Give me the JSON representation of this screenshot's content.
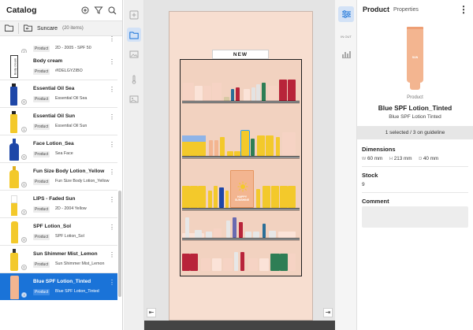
{
  "catalog": {
    "title": "Catalog",
    "folder": {
      "name": "Suncare",
      "count": "(20 items)"
    },
    "items": [
      {
        "name": "",
        "tag": "Product",
        "value": "2D - 2005 - SPF 50",
        "badge": "2"
      },
      {
        "name": "Body cream",
        "tag": "Product",
        "value": "#IDELGYZIBO",
        "badge": "",
        "thumb_text": "Body cream"
      },
      {
        "name": "Essential Oil Sea",
        "tag": "Product",
        "value": "Essential Oil Sea",
        "badge": "0"
      },
      {
        "name": "Essential Oil Sun",
        "tag": "Product",
        "value": "Essential Oil Sun",
        "badge": "1"
      },
      {
        "name": "Face Lotion_Sea",
        "tag": "Product",
        "value": "Sea Face",
        "badge": "0"
      },
      {
        "name": "Fun Size Body Lotion_Yellow",
        "tag": "Product",
        "value": "Fun Size Body Lotion_Yellow",
        "badge": "0"
      },
      {
        "name": "LIPS - Faded Sun",
        "tag": "Product",
        "value": "2D - 2004 Yellow",
        "badge": "2"
      },
      {
        "name": "SPF Lotion_Sol",
        "tag": "Product",
        "value": "SPF Lotion_Sol",
        "badge": "0"
      },
      {
        "name": "Sun Shimmer Mist_Lemon",
        "tag": "Product",
        "value": "Sun Shimmer Mist_Lemon",
        "badge": "0"
      },
      {
        "name": "Blue SPF Lotion_Tinted",
        "tag": "Product",
        "value": "Blue SPF Lotion_Tinted",
        "badge": "3"
      }
    ]
  },
  "rail": {
    "icons": [
      "add-icon",
      "folder-icon",
      "image-icon",
      "temperature-icon",
      "picture-icon"
    ]
  },
  "canvas": {
    "sign": "NEW",
    "nav_left": "⇤",
    "nav_right": "⇥",
    "box_text": "HAPPY SUNSHINE",
    "bottle_text": "SUN"
  },
  "side_tools": {
    "out_label": "IN OUT"
  },
  "properties": {
    "tab_active": "Product",
    "tab_other": "Properties",
    "product_type": "Product",
    "product_name": "Blue SPF Lotion_Tinted",
    "product_sub": "Blue SPF Lotion Tinted",
    "status": "1 selected / 3 on guideline",
    "dimensions_title": "Dimensions",
    "dimensions": {
      "w_label": "W",
      "w": "60 mm",
      "h_label": "H",
      "h": "213 mm",
      "d_label": "D",
      "d": "40 mm"
    },
    "stock_title": "Stock",
    "stock": "9",
    "comment_title": "Comment",
    "comment": ""
  },
  "colors": {
    "accent": "#1a73d8",
    "tube_peach": "#f3b590",
    "cabinet": "#f7ded0",
    "yellow": "#f3c92b",
    "navy": "#1e47a8",
    "red": "#b8243a",
    "green": "#2e7e55"
  }
}
